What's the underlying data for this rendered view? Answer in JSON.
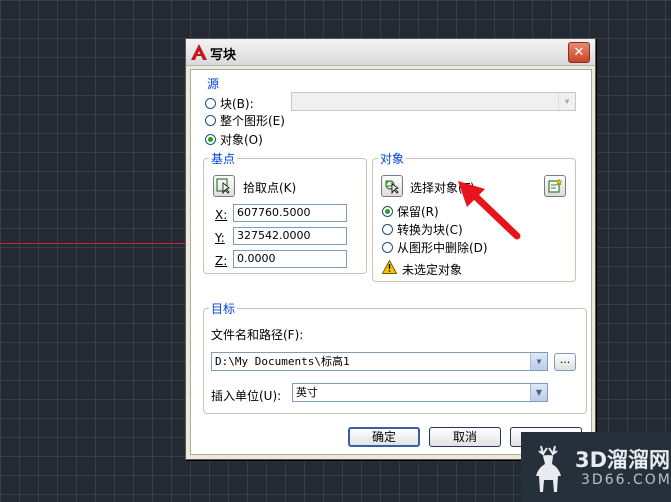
{
  "dialog": {
    "title": "写块",
    "close": "✕"
  },
  "source": {
    "label": "源",
    "block_label": "块(B):",
    "entire_drawing_label": "整个图形(E)",
    "objects_label": "对象(O)",
    "selected": "objects"
  },
  "base_point": {
    "label": "基点",
    "pick_label": "拾取点(K)",
    "x_label": "X:",
    "x_value": "607760.5000",
    "y_label": "Y:",
    "y_value": "327542.0000",
    "z_label": "Z:",
    "z_value": "0.0000"
  },
  "objects": {
    "label": "对象",
    "select_label": "选择对象(T)",
    "retain_label": "保留(R)",
    "convert_label": "转换为块(C)",
    "delete_label": "从图形中删除(D)",
    "status_text": "未选定对象",
    "selected": "retain"
  },
  "destination": {
    "label": "目标",
    "path_label": "文件名和路径(F):",
    "path_value": "D:\\My Documents\\标高1",
    "browse_label": "...",
    "units_label": "插入单位(U):",
    "units_value": "英寸"
  },
  "buttons": {
    "ok": "确定",
    "cancel": "取消"
  },
  "watermark": {
    "brand": "3D溜溜网",
    "domain": "3D66.COM"
  },
  "colors": {
    "accent": "#0046d5",
    "arrow": "#e8141b",
    "radio_dot": "#21a121"
  }
}
